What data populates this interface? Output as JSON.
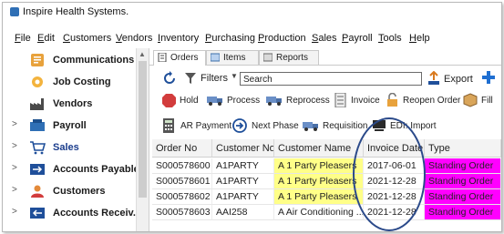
{
  "window": {
    "title": "Inspire Health Systems."
  },
  "menu": [
    "File",
    "Edit",
    "Customers",
    "Vendors",
    "Inventory",
    "Purchasing",
    "Production",
    "Sales",
    "Payroll",
    "Tools",
    "Help"
  ],
  "sidebar": {
    "items": [
      {
        "label": "Communications",
        "chevron": ""
      },
      {
        "label": "Job Costing",
        "chevron": ""
      },
      {
        "label": "Vendors",
        "chevron": ""
      },
      {
        "label": "Payroll",
        "chevron": ">"
      },
      {
        "label": "Sales",
        "chevron": ">"
      },
      {
        "label": "Accounts Payable",
        "chevron": ">"
      },
      {
        "label": "Customers",
        "chevron": ">"
      },
      {
        "label": "Accounts Receiv...",
        "chevron": ">"
      }
    ]
  },
  "tabs": [
    {
      "label": "Orders"
    },
    {
      "label": "Items"
    },
    {
      "label": "Reports"
    }
  ],
  "filter": {
    "label": "Filters",
    "search_value": "Search",
    "export_label": "Export"
  },
  "actions_row1": [
    "Hold",
    "Process",
    "Reprocess",
    "Invoice",
    "Reopen Order",
    "Fill"
  ],
  "actions_row2": [
    "AR Payment",
    "Next Phase",
    "Requisition",
    "EDI: Import"
  ],
  "table": {
    "columns": [
      "Order No",
      "Customer No.",
      "Customer Name",
      "Invoice Date",
      "Type"
    ],
    "rows": [
      [
        "S000578600",
        "A1PARTY",
        "A 1 Party Pleasers",
        "2017-06-01",
        "Standing Order"
      ],
      [
        "S000578601",
        "A1PARTY",
        "A 1 Party Pleasers",
        "2021-12-28",
        "Standing Order"
      ],
      [
        "S000578602",
        "A1PARTY",
        "A 1 Party Pleasers",
        "2021-12-28",
        "Standing Order"
      ],
      [
        "S000578603",
        "AAI258",
        "A Air Conditioning ...",
        "2021-12-28",
        "Standing Order"
      ]
    ]
  },
  "colors": {
    "highlight_name": "#ffff88",
    "highlight_type": "#ff00ff",
    "annotation_circle": "#2b4a8a",
    "accent": "#1a3c8c"
  }
}
